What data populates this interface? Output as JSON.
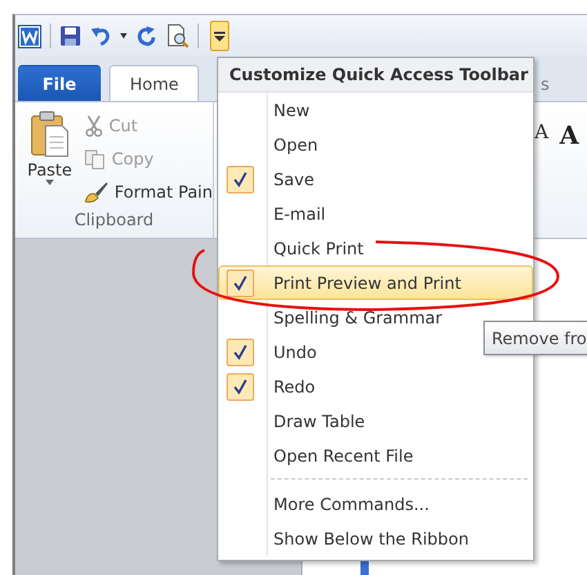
{
  "tabs": [
    {
      "label": "File",
      "kind": "file",
      "selected": false
    },
    {
      "label": "Home",
      "kind": "tab",
      "selected": true
    },
    {
      "label": "s",
      "kind": "tab",
      "selected": false
    }
  ],
  "clipboard": {
    "paste": "Paste",
    "commands": [
      {
        "label": "Cut",
        "kind": "cut",
        "disabled": true
      },
      {
        "label": "Copy",
        "kind": "copy",
        "disabled": true
      },
      {
        "label": "Format Pain",
        "kind": "brush",
        "disabled": false
      }
    ],
    "group_label": "Clipboard"
  },
  "font_controls": [
    "A",
    "A"
  ],
  "menu": {
    "title": "Customize Quick Access Toolbar",
    "items": [
      {
        "kind": "item",
        "label": "New",
        "checked": false,
        "selected": false
      },
      {
        "kind": "item",
        "label": "Open",
        "checked": false,
        "selected": false
      },
      {
        "kind": "item",
        "label": "Save",
        "checked": true,
        "selected": false
      },
      {
        "kind": "item",
        "label": "E-mail",
        "checked": false,
        "selected": false
      },
      {
        "kind": "item",
        "label": "Quick Print",
        "checked": false,
        "selected": false
      },
      {
        "kind": "item",
        "label": "Print Preview and Print",
        "checked": true,
        "selected": true
      },
      {
        "kind": "item",
        "label": "Spelling & Grammar",
        "checked": false,
        "selected": false
      },
      {
        "kind": "item",
        "label": "Undo",
        "checked": true,
        "selected": false
      },
      {
        "kind": "item",
        "label": "Redo",
        "checked": true,
        "selected": false
      },
      {
        "kind": "item",
        "label": "Draw Table",
        "checked": false,
        "selected": false
      },
      {
        "kind": "item",
        "label": "Open Recent File",
        "checked": false,
        "selected": false
      },
      {
        "kind": "separator"
      },
      {
        "kind": "item",
        "label": "More Commands...",
        "checked": false,
        "selected": false
      },
      {
        "kind": "item",
        "label": "Show Below the Ribbon",
        "checked": false,
        "selected": false
      }
    ]
  },
  "tooltip": {
    "text": "Remove fro"
  }
}
